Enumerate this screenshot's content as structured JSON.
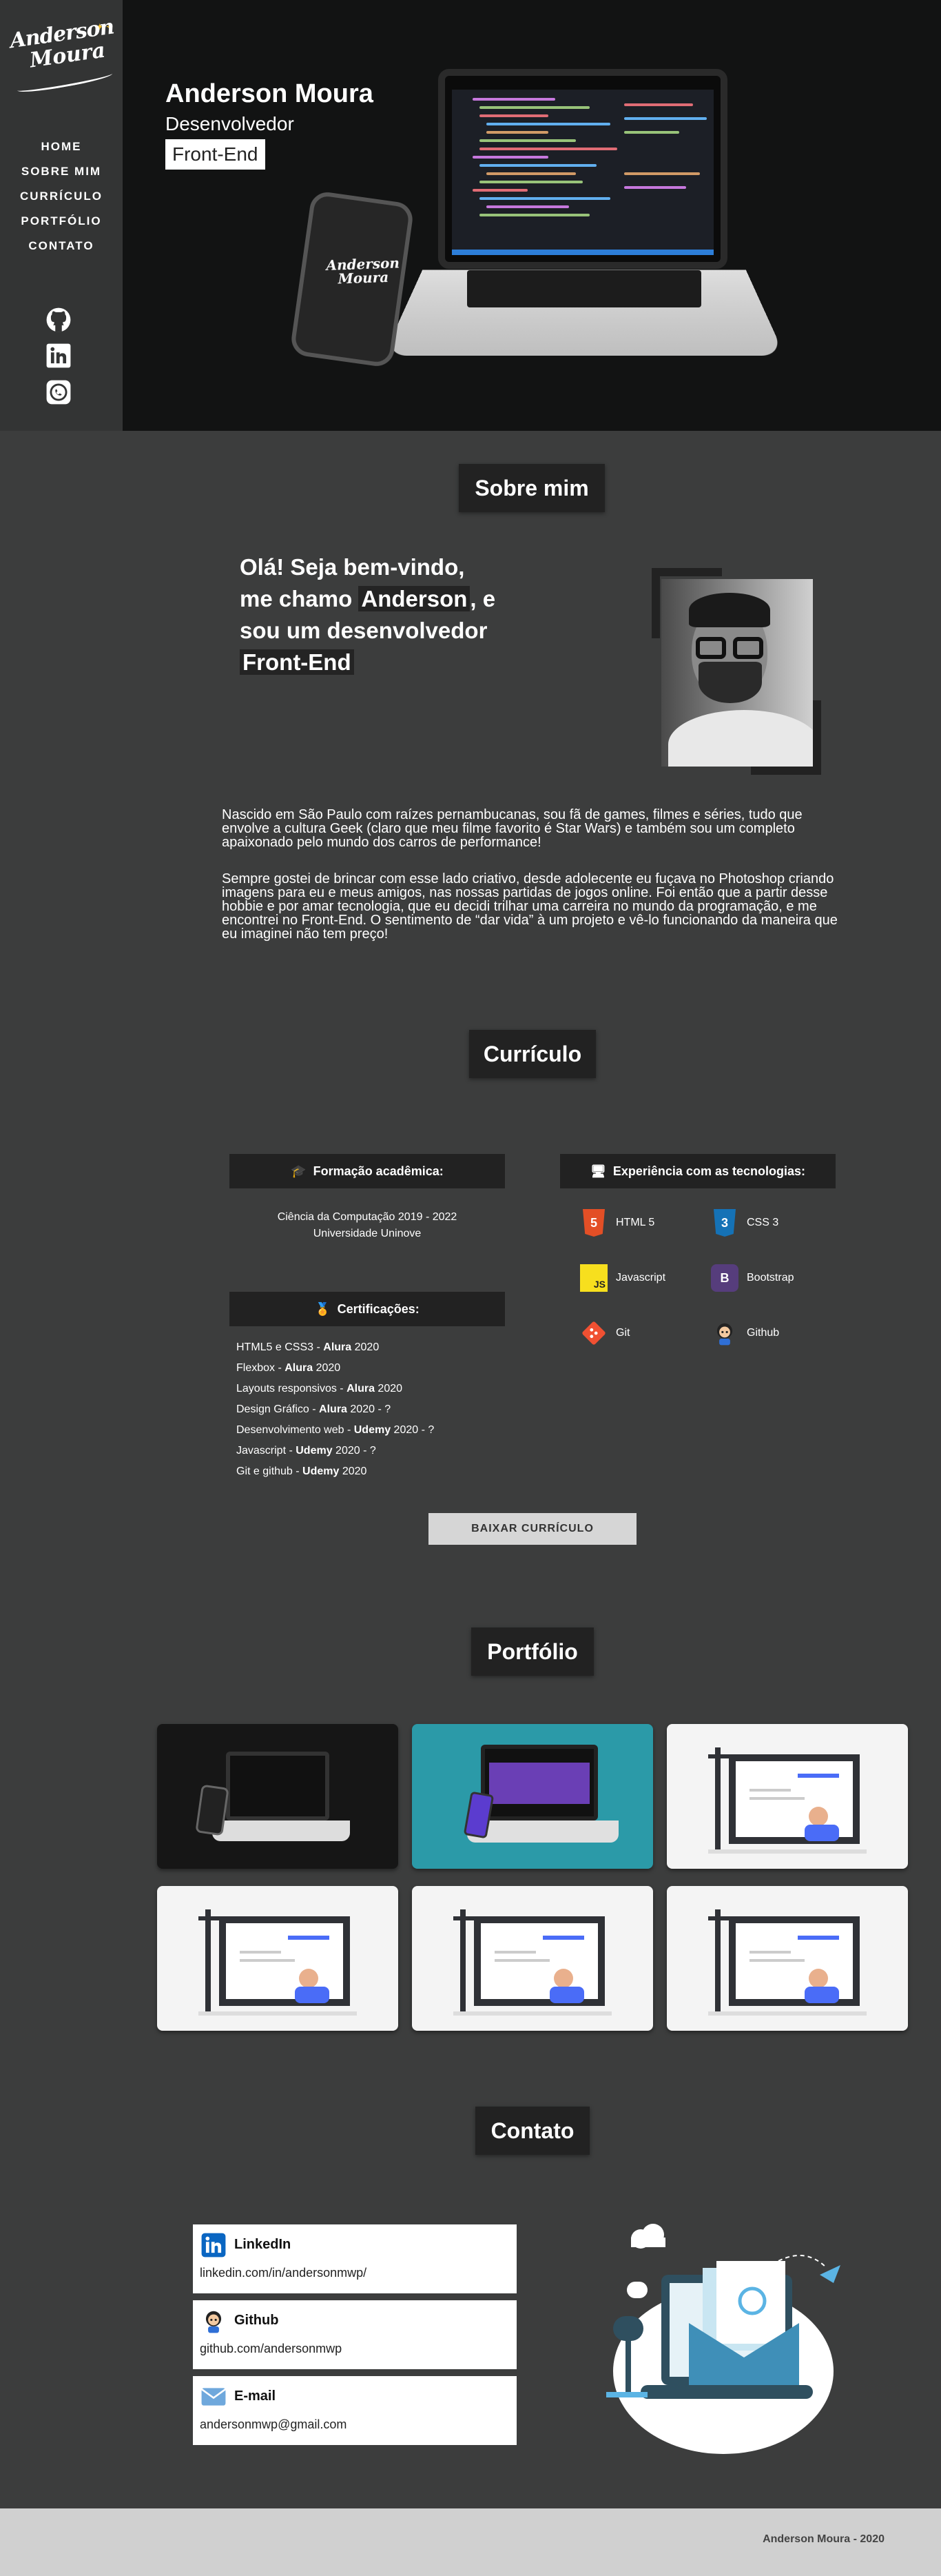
{
  "brand": {
    "logo_line1": "Anderson",
    "logo_line2": "Moura"
  },
  "nav": [
    "HOME",
    "SOBRE MIM",
    "CURRÍCULO",
    "PORTFÓLIO",
    "CONTATO"
  ],
  "social_icons": [
    "github-icon",
    "linkedin-icon",
    "whatsapp-icon"
  ],
  "hero": {
    "name": "Anderson Moura",
    "role": "Desenvolvedor",
    "highlight": "Front-End",
    "phone_logo_line1": "Anderson",
    "phone_logo_line2": "Moura"
  },
  "about": {
    "title": "Sobre mim",
    "welcome_1": "Olá! Seja bem-vindo,",
    "welcome_2a": "me chamo ",
    "welcome_name": "Anderson",
    "welcome_2b": ", e",
    "welcome_3": "sou um desenvolvedor",
    "welcome_fe": "Front-End",
    "p1": "Nascido em São Paulo com raízes pernambucanas, sou fã de games, filmes e séries, tudo que envolve a cultura Geek (claro que meu filme favorito é Star Wars) e também sou um completo apaixonado pelo mundo dos carros de performance!",
    "p2": "Sempre gostei de brincar com esse lado criativo, desde adolecente eu fuçava no Photoshop criando imagens para eu e meus amigos, nas nossas partidas de jogos online. Foi então que a partir desse hobbie e por amar tecnologia, que eu decidi trilhar uma carreira no mundo da programação, e me encontrei no Front-End. O sentimento de “dar vida” à um projeto e vê-lo funcionando da maneira que eu imaginei não tem preço!"
  },
  "cv": {
    "title": "Currículo",
    "education_title": "Formação acadêmica:",
    "education_line1": "Ciência da Computação 2019 - 2022",
    "education_line2": "Universidade Uninove",
    "cert_title": "Certificações:",
    "certs": [
      {
        "name": "HTML5 e CSS3 - ",
        "school": "Alura",
        "year": " 2020"
      },
      {
        "name": "Flexbox - ",
        "school": "Alura",
        "year": " 2020"
      },
      {
        "name": "Layouts responsivos - ",
        "school": "Alura",
        "year": " 2020"
      },
      {
        "name": "Design Gráfico - ",
        "school": "Alura",
        "year": " 2020 - ?"
      },
      {
        "name": "Desenvolvimento web - ",
        "school": "Udemy",
        "year": " 2020 - ?"
      },
      {
        "name": "Javascript - ",
        "school": "Udemy",
        "year": " 2020 - ?"
      },
      {
        "name": "Git e github - ",
        "school": "Udemy",
        "year": " 2020"
      }
    ],
    "tech_title": "Experiência com as tecnologias:",
    "techs": [
      {
        "label": "HTML 5",
        "glyph": "5",
        "color": "#e34f26"
      },
      {
        "label": "CSS 3",
        "glyph": "3",
        "color": "#1572b6"
      },
      {
        "label": "Javascript",
        "glyph": "JS",
        "color": "#f7df1e"
      },
      {
        "label": "Bootstrap",
        "glyph": "B",
        "color": "#563d7c"
      },
      {
        "label": "Git",
        "glyph": "◆",
        "color": "#f05032"
      },
      {
        "label": "Github",
        "glyph": "●",
        "color": "#222222"
      }
    ],
    "download_label": "BAIXAR CURRÍCULO"
  },
  "portfolio": {
    "title": "Portfólio"
  },
  "contact": {
    "title": "Contato",
    "items": [
      {
        "title": "LinkedIn",
        "value": "linkedin.com/in/andersonmwp/"
      },
      {
        "title": "Github",
        "value": "github.com/andersonmwp"
      },
      {
        "title": "E-mail",
        "value": "andersonmwp@gmail.com"
      }
    ]
  },
  "footer": {
    "text": "Anderson Moura - 2020"
  },
  "colors": {
    "background": "#3c3d3d",
    "sidebar": "#333434",
    "hero": "#121313",
    "title_box": "#222222",
    "footer": "#d0d0d0"
  }
}
